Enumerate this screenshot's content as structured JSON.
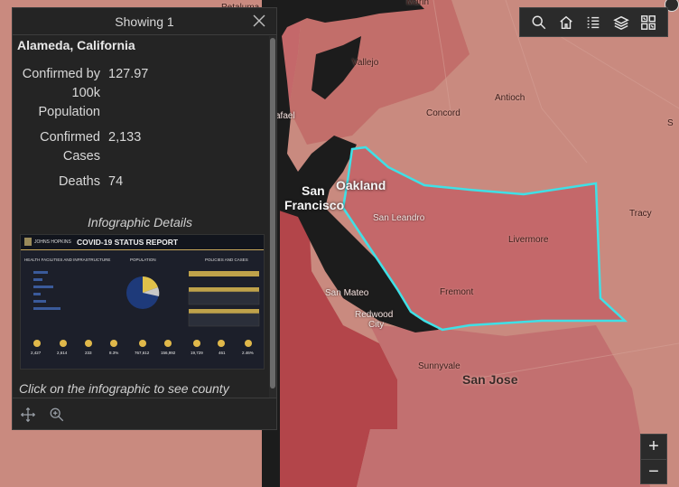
{
  "map": {
    "labels": {
      "vallejo": "Vallejo",
      "antioch": "Antioch",
      "concord": "Concord",
      "rafael": "afael",
      "petaluma": "Petaluma",
      "top_cut": "Marin",
      "s_edge": "S",
      "oakland": "Oakland",
      "san_francisco_1": "San",
      "san_francisco_2": "Francisco",
      "san_leandro": "San Leandro",
      "tracy": "Tracy",
      "livermore": "Livermore",
      "san_mateo": "San Mateo",
      "fremont": "Fremont",
      "redwood_city_1": "Redwood",
      "redwood_city_2": "City",
      "sunnyvale": "Sunnyvale",
      "san_jose": "San Jose"
    },
    "colors": {
      "water": "#1c1c1c",
      "light_fill": "#c98a7f",
      "mid_fill": "#c4686a",
      "dark_fill": "#b3454a",
      "selection_outline": "#3fe0e6"
    }
  },
  "toolbar": {
    "buttons": [
      {
        "name": "search-button",
        "icon": "search-icon"
      },
      {
        "name": "home-button",
        "icon": "home-icon"
      },
      {
        "name": "legend-button",
        "icon": "list-icon"
      },
      {
        "name": "layers-button",
        "icon": "layers-icon"
      },
      {
        "name": "basemap-button",
        "icon": "grid-icon"
      }
    ]
  },
  "zoom": {
    "in_label": "+",
    "out_label": "−"
  },
  "popup": {
    "title": "Showing 1",
    "feature_title": "Alameda, California",
    "fields": [
      {
        "label": "Confirmed by 100k Population",
        "value": "127.97"
      },
      {
        "label": "Confirmed Cases",
        "value": "2,133"
      },
      {
        "label": "Deaths",
        "value": "74"
      }
    ],
    "infographic_heading": "Infographic Details",
    "infographic_note": "Click on the infographic to see county",
    "infographic": {
      "title": "COVID-19 STATUS REPORT",
      "logo_text": "JOHNS HOPKINS",
      "section_health": "HEALTH FACILITIES AND INFRASTRUCTURE",
      "section_population": "POPULATION",
      "section_policies": "POLICIES AND CASES",
      "stats": [
        "2,427",
        "2,614",
        "233",
        "8.3%",
        "767,612",
        "156,992",
        "19,729",
        "461",
        "2.46%"
      ]
    }
  }
}
